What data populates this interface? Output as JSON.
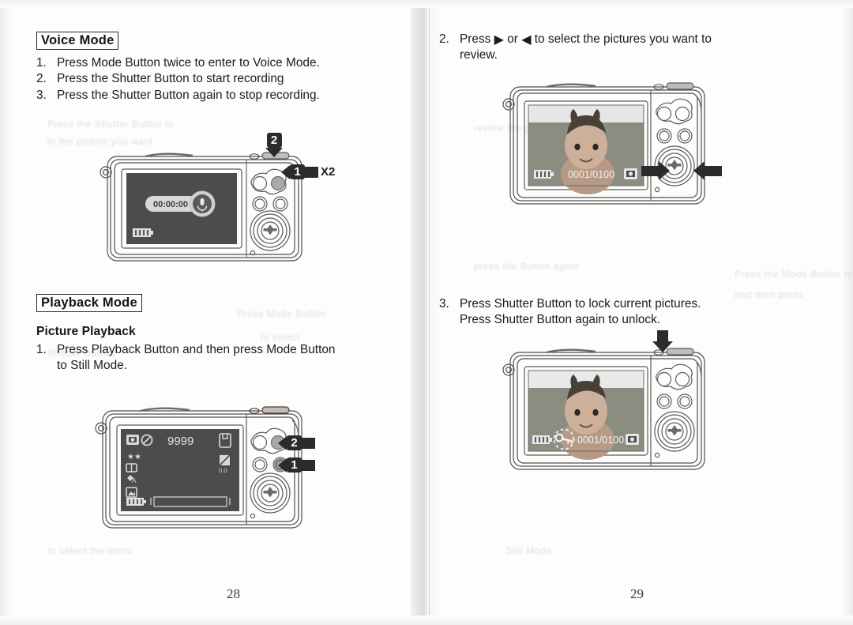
{
  "document": {
    "kind": "scanned-camera-manual-spread",
    "left_page_number": "28",
    "right_page_number": "29"
  },
  "left_page": {
    "section1": {
      "heading": "Voice Mode",
      "steps": [
        {
          "num": "1.",
          "text": "Press Mode Button twice to enter to Voice Mode."
        },
        {
          "num": "2.",
          "text": "Press the Shutter Button to start recording"
        },
        {
          "num": "3.",
          "text": "Press the Shutter Button again to stop recording."
        }
      ],
      "figure": {
        "name": "camera-back-voice-mode",
        "lcd": {
          "timer": "00:00:00",
          "mic_icon": "microphone-icon",
          "battery_icon": "battery-full-icon"
        },
        "callouts": [
          {
            "label": "2",
            "target": "shutter-button",
            "direction": "down"
          },
          {
            "label": "1",
            "target": "mode-button",
            "direction": "left",
            "suffix": "X2"
          }
        ]
      }
    },
    "section2": {
      "heading": "Playback Mode",
      "subheading": "Picture Playback",
      "steps": [
        {
          "num": "1.",
          "text": "Press Playback Button and then press Mode Button",
          "cont": "to Still Mode."
        }
      ],
      "figure": {
        "name": "camera-back-playback-still-mode",
        "lcd": {
          "counter": "9999",
          "ev_value": "0.0",
          "icons": [
            "still-camera-icon",
            "flash-off-icon",
            "sd-card-icon",
            "ev-compensation-icon",
            "image-quality-icon",
            "image-size-icon",
            "white-balance-auto-icon",
            "scene-mode-icon",
            "battery-full-icon",
            "zoom-bar-icon"
          ]
        },
        "callouts": [
          {
            "label": "2",
            "target": "mode-button",
            "direction": "left"
          },
          {
            "label": "1",
            "target": "playback-button",
            "direction": "left"
          }
        ]
      }
    }
  },
  "right_page": {
    "steps": [
      {
        "num": "2.",
        "pre": "Press",
        "icon_right": "▶",
        "mid": "or",
        "icon_left": "◀",
        "post": "to select the pictures you want to",
        "cont": "review."
      },
      {
        "num": "3.",
        "text": "Press Shutter Button to lock current pictures.",
        "cont": "Press Shutter Button again to unlock."
      }
    ],
    "figure1": {
      "name": "camera-back-review-pictures",
      "lcd": {
        "counter": "0001/0100",
        "battery_icon": "battery-full-icon",
        "playback_icon": "playback-image-icon",
        "photo": "photo-of-child"
      },
      "callouts": [
        {
          "target": "four-way-pad",
          "direction": "right"
        },
        {
          "target": "four-way-pad",
          "direction": "left"
        }
      ]
    },
    "figure2": {
      "name": "camera-back-lock-picture",
      "lcd": {
        "counter": "0001/0100",
        "battery_icon": "battery-full-icon",
        "lock_icon": "key-lock-icon",
        "playback_icon": "playback-image-icon",
        "photo": "photo-of-child"
      },
      "callouts": [
        {
          "target": "shutter-button",
          "direction": "down"
        }
      ]
    }
  },
  "ghost_text": {
    "items": [
      "Press the Shutter Button to",
      "in the picture you want",
      "Press Mode Button",
      "to select",
      "Shutter Button",
      "review the pictures",
      "press the Button again",
      "Press the Mode Button to",
      "and then press",
      "to select the menu",
      "Still Mode"
    ]
  },
  "colors": {
    "ink": "#1a1a1a",
    "paper": "#fdfdfc",
    "callout": "#2b2b2b",
    "lcd": "#4a4a4a"
  }
}
